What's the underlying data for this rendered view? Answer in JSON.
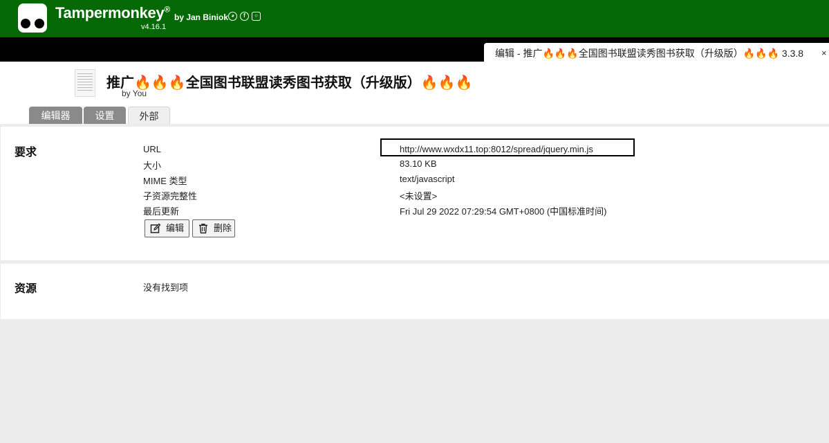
{
  "app": {
    "name": "Tampermonkey",
    "registered_mark": "®",
    "byline": "by Jan Biniok",
    "version": "v4.16.1"
  },
  "tab": {
    "title": "编辑 - 推广🔥🔥🔥全国图书联盟读秀图书获取（升级版）🔥🔥🔥 3.3.8",
    "close": "×"
  },
  "script": {
    "title": "推广🔥🔥🔥全国图书联盟读秀图书获取（升级版）🔥🔥🔥",
    "author": "by You"
  },
  "tabs": [
    "编辑器",
    "设置",
    "外部"
  ],
  "requires": {
    "heading": "要求",
    "rows": [
      {
        "label": "URL",
        "value": "http://www.wxdx11.top:8012/spread/jquery.min.js"
      },
      {
        "label": "大小",
        "value": "83.10 KB"
      },
      {
        "label": "MIME 类型",
        "value": "text/javascript"
      },
      {
        "label": "子资源完整性",
        "value": "<未设置>"
      },
      {
        "label": "最后更新",
        "value": "Fri Jul 29 2022 07:29:54 GMT+0800 (中国标准时间)"
      }
    ],
    "edit_label": "编辑",
    "delete_label": "删除"
  },
  "resources": {
    "heading": "资源",
    "empty_text": "没有找到项"
  },
  "icons": [
    "github-icon",
    "facebook-icon",
    "instagram-icon",
    "edit-icon",
    "trash-icon"
  ],
  "colors": {
    "header_green": "#046905",
    "tab_dark": "#8a8a8a"
  }
}
